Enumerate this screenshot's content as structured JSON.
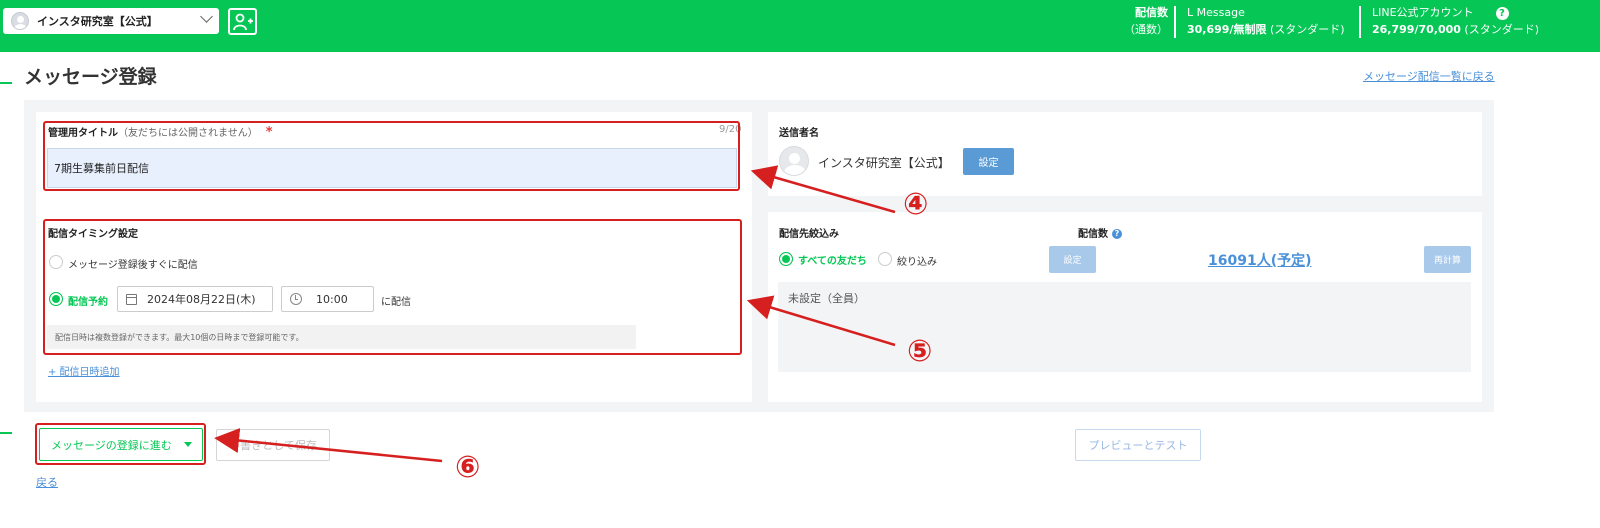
{
  "header": {
    "account_name": "インスタ研究室【公式】",
    "stats": {
      "delivery_label": "配信数",
      "delivery_sub": "（通数）",
      "lmessage_label": "L Message",
      "lmessage_value": "30,699/無制限",
      "lmessage_plan": "(スタンダード)",
      "line_label": "LINE公式アカウント",
      "line_value": "26,799/70,000",
      "line_plan": "(スタンダード)",
      "help_glyph": "?"
    }
  },
  "page": {
    "title": "メッセージ登録",
    "back_to_list": "メッセージ配信一覧に戻る"
  },
  "form": {
    "title_field": {
      "label": "管理用タイトル",
      "note": "（友だちには公開されません）",
      "required_mark": "*",
      "count": "9/20",
      "value": "7期生募集前日配信"
    },
    "timing": {
      "label": "配信タイミング設定",
      "option_immediate": "メッセージ登録後すぐに配信",
      "option_scheduled": "配信予約",
      "date": "2024年08月22日(木)",
      "time": "10:00",
      "suffix": "に配信",
      "note": "配信日時は複数登録ができます。最大10個の日時まで登録可能です。",
      "add_link": "+ 配信日時追加"
    },
    "sender": {
      "label": "送信者名",
      "name": "インスタ研究室【公式】",
      "set_button": "設定"
    },
    "target": {
      "label": "配信先絞込み",
      "count_label": "配信数",
      "option_all": "すべての友だち",
      "option_filter": "絞り込み",
      "set_button": "設定",
      "count_value": "16091人(予定)",
      "recalc_button": "再計算",
      "filter_text": "未設定（全員）"
    }
  },
  "actions": {
    "proceed": "メッセージの登録に進む",
    "save_draft": "下書きとして保存",
    "preview": "プレビューとテスト",
    "back": "戻る"
  },
  "annotations": {
    "n4": "④",
    "n5": "⑤",
    "n6": "⑥"
  },
  "colors": {
    "brand_green": "#06c755",
    "annotation_red": "#d61f1f",
    "link_blue": "#4a90d9"
  }
}
